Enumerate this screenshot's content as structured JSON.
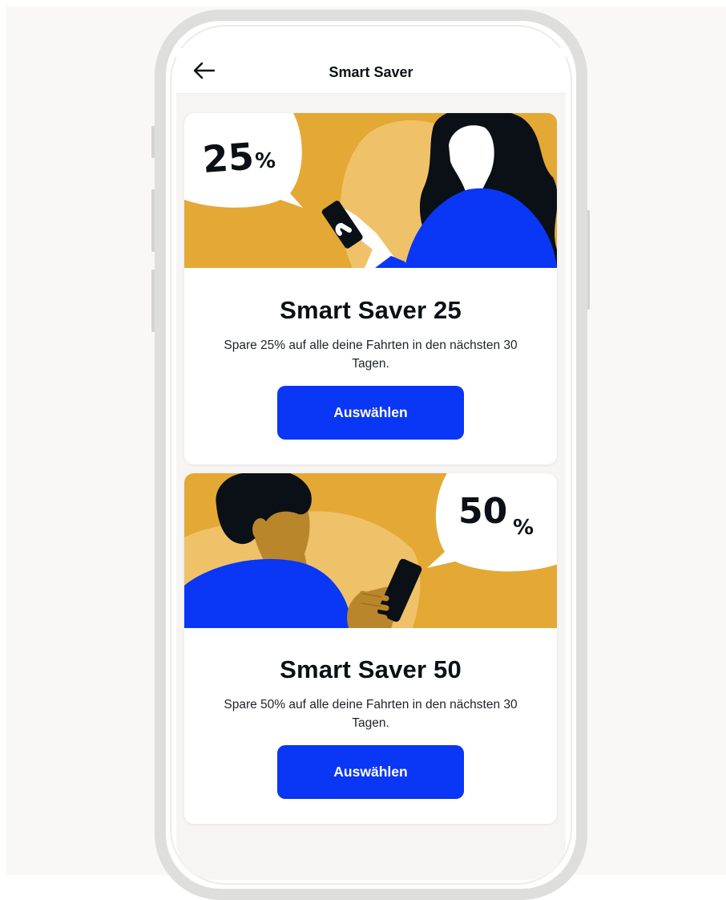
{
  "header": {
    "title": "Smart Saver",
    "back_icon": "arrow-left-icon"
  },
  "plans": [
    {
      "percent_number": "25",
      "percent_sign": "%",
      "title": "Smart Saver 25",
      "description": "Spare 25% auf alle deine Fahrten in den nächsten 30 Tagen.",
      "button_label": "Auswählen"
    },
    {
      "percent_number": "50",
      "percent_sign": "%",
      "title": "Smart Saver 50",
      "description": "Spare 50% auf alle deine Fahrten in den nächsten 30 Tagen.",
      "button_label": "Auswählen"
    }
  ],
  "colors": {
    "accent_blue": "#0a36f5",
    "art_yellow": "#e3a934",
    "art_light_yellow": "#efc26a",
    "ink": "#0b1016",
    "skin_dark": "#b9862c"
  }
}
